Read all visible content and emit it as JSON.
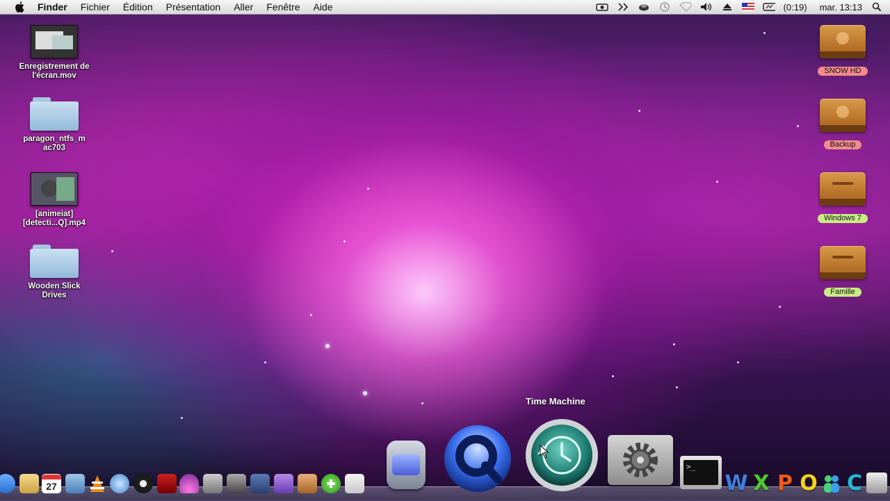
{
  "menubar": {
    "app_name": "Finder",
    "items": [
      "Fichier",
      "Édition",
      "Présentation",
      "Aller",
      "Fenêtre",
      "Aide"
    ],
    "battery_text": "(0:19)",
    "clock": "mar. 13:13"
  },
  "desktop_left": [
    {
      "label": "Enregistrement de l'écran.mov",
      "kind": "movie"
    },
    {
      "label": "paragon_ntfs_m ac703",
      "kind": "folder"
    },
    {
      "label": "[animeiat] [detecti...Q].mp4",
      "kind": "movie"
    },
    {
      "label": "Wooden Slick Drives",
      "kind": "folder"
    }
  ],
  "desktop_right": [
    {
      "label": "SNOW HD",
      "tag_color": "#f28b8b"
    },
    {
      "label": "Backup",
      "tag_color": "#f28b8b"
    },
    {
      "label": "Windows 7",
      "tag_color": "#c8ec84"
    },
    {
      "label": "Famille",
      "tag_color": "#c8ec84"
    }
  ],
  "dock": {
    "tooltip": "Time Machine",
    "calendar_day": "27",
    "letters": [
      "W",
      "X",
      "P",
      "O",
      "C"
    ]
  }
}
